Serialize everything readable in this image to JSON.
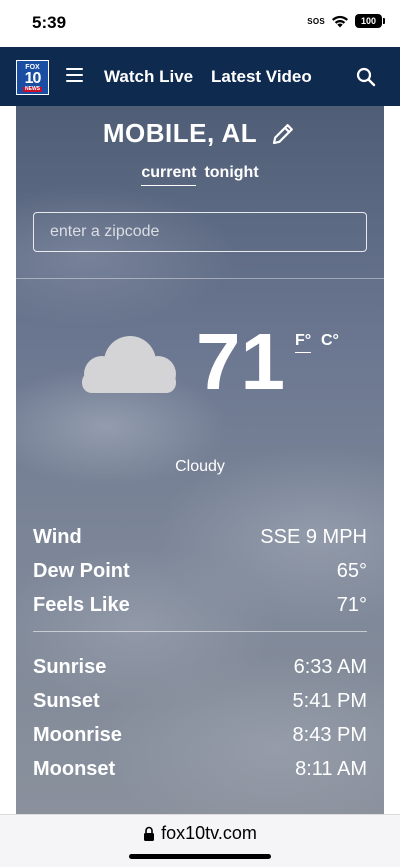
{
  "status_bar": {
    "time": "5:39",
    "sos": "SOS",
    "battery": "100"
  },
  "navbar": {
    "logo_top": "FOX",
    "logo_number": "10",
    "logo_bottom": "NEWS",
    "links": [
      "Watch Live",
      "Latest Video"
    ],
    "icons": [
      "menu-icon",
      "search-icon"
    ]
  },
  "weather": {
    "city": "MOBILE, AL",
    "tabs": [
      "current",
      "tonight"
    ],
    "active_tab": "current",
    "zip_placeholder": "enter a zipcode",
    "zip_value": "",
    "condition_icon": "cloud-icon",
    "temperature": "71",
    "units": [
      "F°",
      "C°"
    ],
    "active_unit": "F°",
    "condition": "Cloudy",
    "conditions_details": [
      {
        "label": "Wind",
        "value": "SSE 9 MPH"
      },
      {
        "label": "Dew Point",
        "value": "65°"
      },
      {
        "label": "Feels Like",
        "value": "71°"
      }
    ],
    "astro_details": [
      {
        "label": "Sunrise",
        "value": "6:33 AM"
      },
      {
        "label": "Sunset",
        "value": "5:41 PM"
      },
      {
        "label": "Moonrise",
        "value": "8:43 PM"
      },
      {
        "label": "Moonset",
        "value": "8:11 AM"
      }
    ]
  },
  "browser": {
    "url": "fox10tv.com",
    "icon": "lock-icon"
  },
  "colors": {
    "navbar": "#0f2a4f",
    "logo": "#1a4ea3",
    "logo_news": "#c8102e",
    "text_light": "#ffffff"
  }
}
